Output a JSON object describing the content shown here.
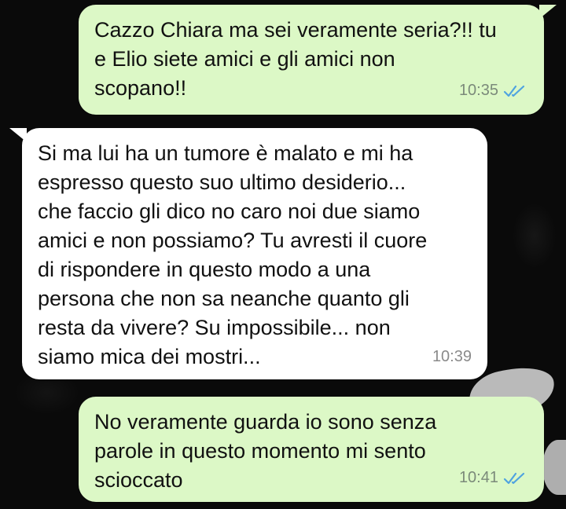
{
  "chat": {
    "messages": [
      {
        "direction": "outgoing",
        "text": "Cazzo Chiara ma sei veramente seria?!! tu\ne Elio siete amici e gli amici non\nscopano!!",
        "time": "10:35",
        "status_icon": "double-check-read-icon"
      },
      {
        "direction": "incoming",
        "text": "Si ma lui ha un tumore è malato e mi ha\nespresso questo suo ultimo desiderio...\nche faccio gli dico no caro noi due siamo\namici e non possiamo? Tu avresti il cuore\ndi rispondere in questo modo a una\npersona che non sa neanche quanto gli\nresta da vivere? Su impossibile... non\nsiamo mica dei mostri...",
        "time": "10:39"
      },
      {
        "direction": "outgoing",
        "text": "No veramente guarda io sono senza\nparole in questo momento mi sento\nscioccato",
        "time": "10:41",
        "status_icon": "double-check-read-icon"
      }
    ]
  },
  "colors": {
    "outgoing_bubble": "#dcf8c6",
    "incoming_bubble": "#ffffff",
    "read_ticks": "#4fa3e0",
    "background": "#0a0a0a"
  }
}
